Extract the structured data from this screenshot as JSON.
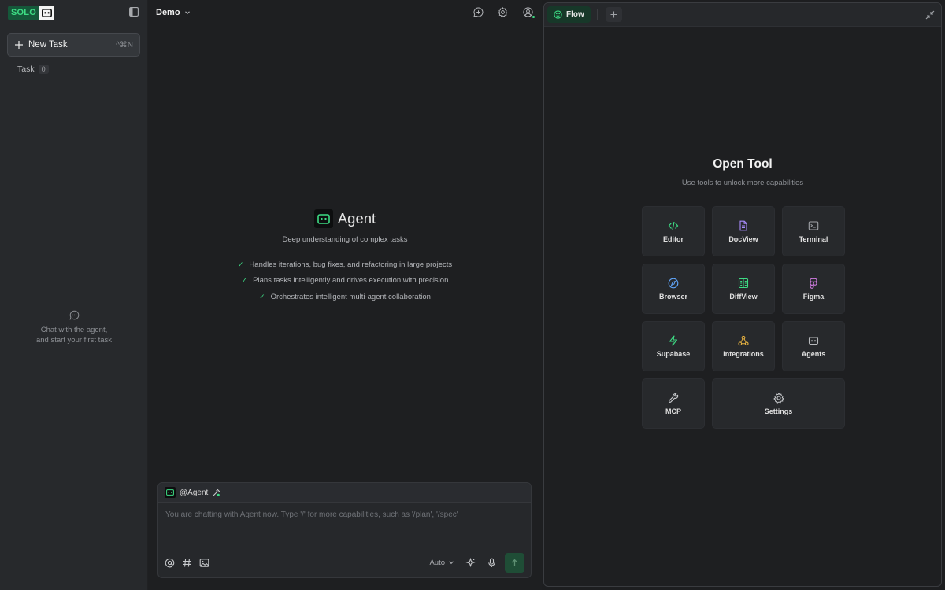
{
  "sidebar": {
    "logo_text": "SOLO",
    "new_task_label": "New Task",
    "new_task_shortcut": "^⌘N",
    "task_label": "Task",
    "task_count": "0",
    "empty_line1": "Chat with the agent,",
    "empty_line2": "and start your first task"
  },
  "header": {
    "workspace": "Demo"
  },
  "agent": {
    "title": "Agent",
    "subtitle": "Deep understanding of complex tasks",
    "features": [
      "Handles iterations, bug fixes, and refactoring in large projects",
      "Plans tasks intelligently and drives execution with precision",
      "Orchestrates intelligent multi-agent collaboration"
    ]
  },
  "chat": {
    "mention": "@Agent",
    "placeholder": "You are chatting with Agent now. Type '/' for more capabilities, such as '/plan', '/spec'",
    "mode": "Auto"
  },
  "tool_panel": {
    "tab_label": "Flow",
    "title": "Open Tool",
    "subtitle": "Use tools to unlock more capabilities",
    "tools": [
      {
        "label": "Editor",
        "icon": "code-icon",
        "color": "#3ddc84"
      },
      {
        "label": "DocView",
        "icon": "document-icon",
        "color": "#a78bfa"
      },
      {
        "label": "Terminal",
        "icon": "terminal-icon",
        "color": "#a0a3a8"
      },
      {
        "label": "Browser",
        "icon": "compass-icon",
        "color": "#60a5fa"
      },
      {
        "label": "DiffView",
        "icon": "diff-icon",
        "color": "#3ddc84"
      },
      {
        "label": "Figma",
        "icon": "figma-icon",
        "color": "#d07be0"
      },
      {
        "label": "Supabase",
        "icon": "bolt-icon",
        "color": "#3ddc84"
      },
      {
        "label": "Integrations",
        "icon": "nodes-icon",
        "color": "#e8b341"
      },
      {
        "label": "Agents",
        "icon": "bot-icon",
        "color": "#b8babd"
      },
      {
        "label": "MCP",
        "icon": "wrench-icon",
        "color": "#c8cacd"
      },
      {
        "label": "Settings",
        "icon": "gear-icon",
        "color": "#c8cacd"
      }
    ]
  },
  "colors": {
    "accent": "#3ddc84",
    "background": "#1e1f21",
    "sidebar": "#27292c"
  }
}
